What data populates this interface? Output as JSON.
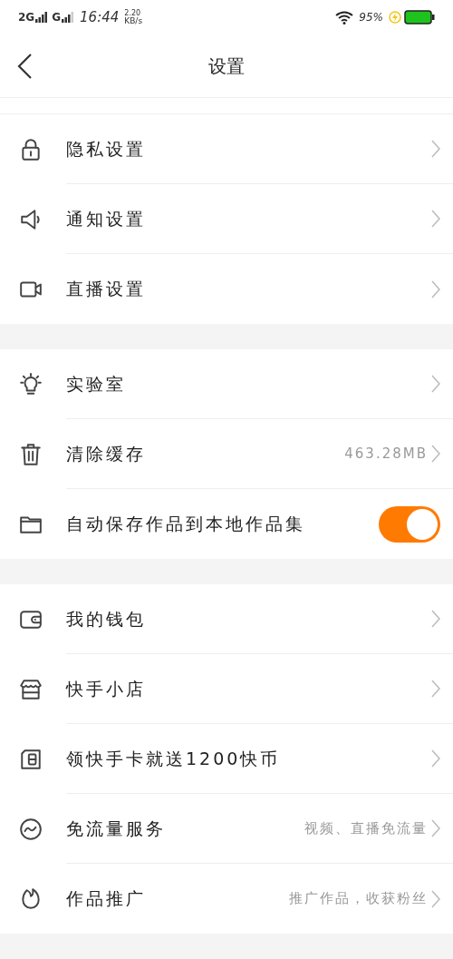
{
  "status_bar": {
    "network_1": "2G",
    "network_2": "G",
    "time": "16:44",
    "speed_value": "2.20",
    "speed_unit": "KB/s",
    "battery_percent": "95%"
  },
  "header": {
    "title": "设置"
  },
  "sections": [
    {
      "items": [
        {
          "label": "隐私设置",
          "kind": "link"
        },
        {
          "label": "通知设置",
          "kind": "link"
        },
        {
          "label": "直播设置",
          "kind": "link"
        }
      ]
    },
    {
      "items": [
        {
          "label": "实验室",
          "kind": "link"
        },
        {
          "label": "清除缓存",
          "kind": "link",
          "value": "463.28MB"
        },
        {
          "label": "自动保存作品到本地作品集",
          "kind": "toggle",
          "on": true
        }
      ]
    },
    {
      "items": [
        {
          "label": "我的钱包",
          "kind": "link"
        },
        {
          "label": "快手小店",
          "kind": "link"
        },
        {
          "label": "领快手卡就送1200快币",
          "kind": "link"
        },
        {
          "label": "免流量服务",
          "kind": "link",
          "value": "视频、直播免流量"
        },
        {
          "label": "作品推广",
          "kind": "link",
          "value": "推广作品，收获粉丝"
        }
      ]
    }
  ]
}
